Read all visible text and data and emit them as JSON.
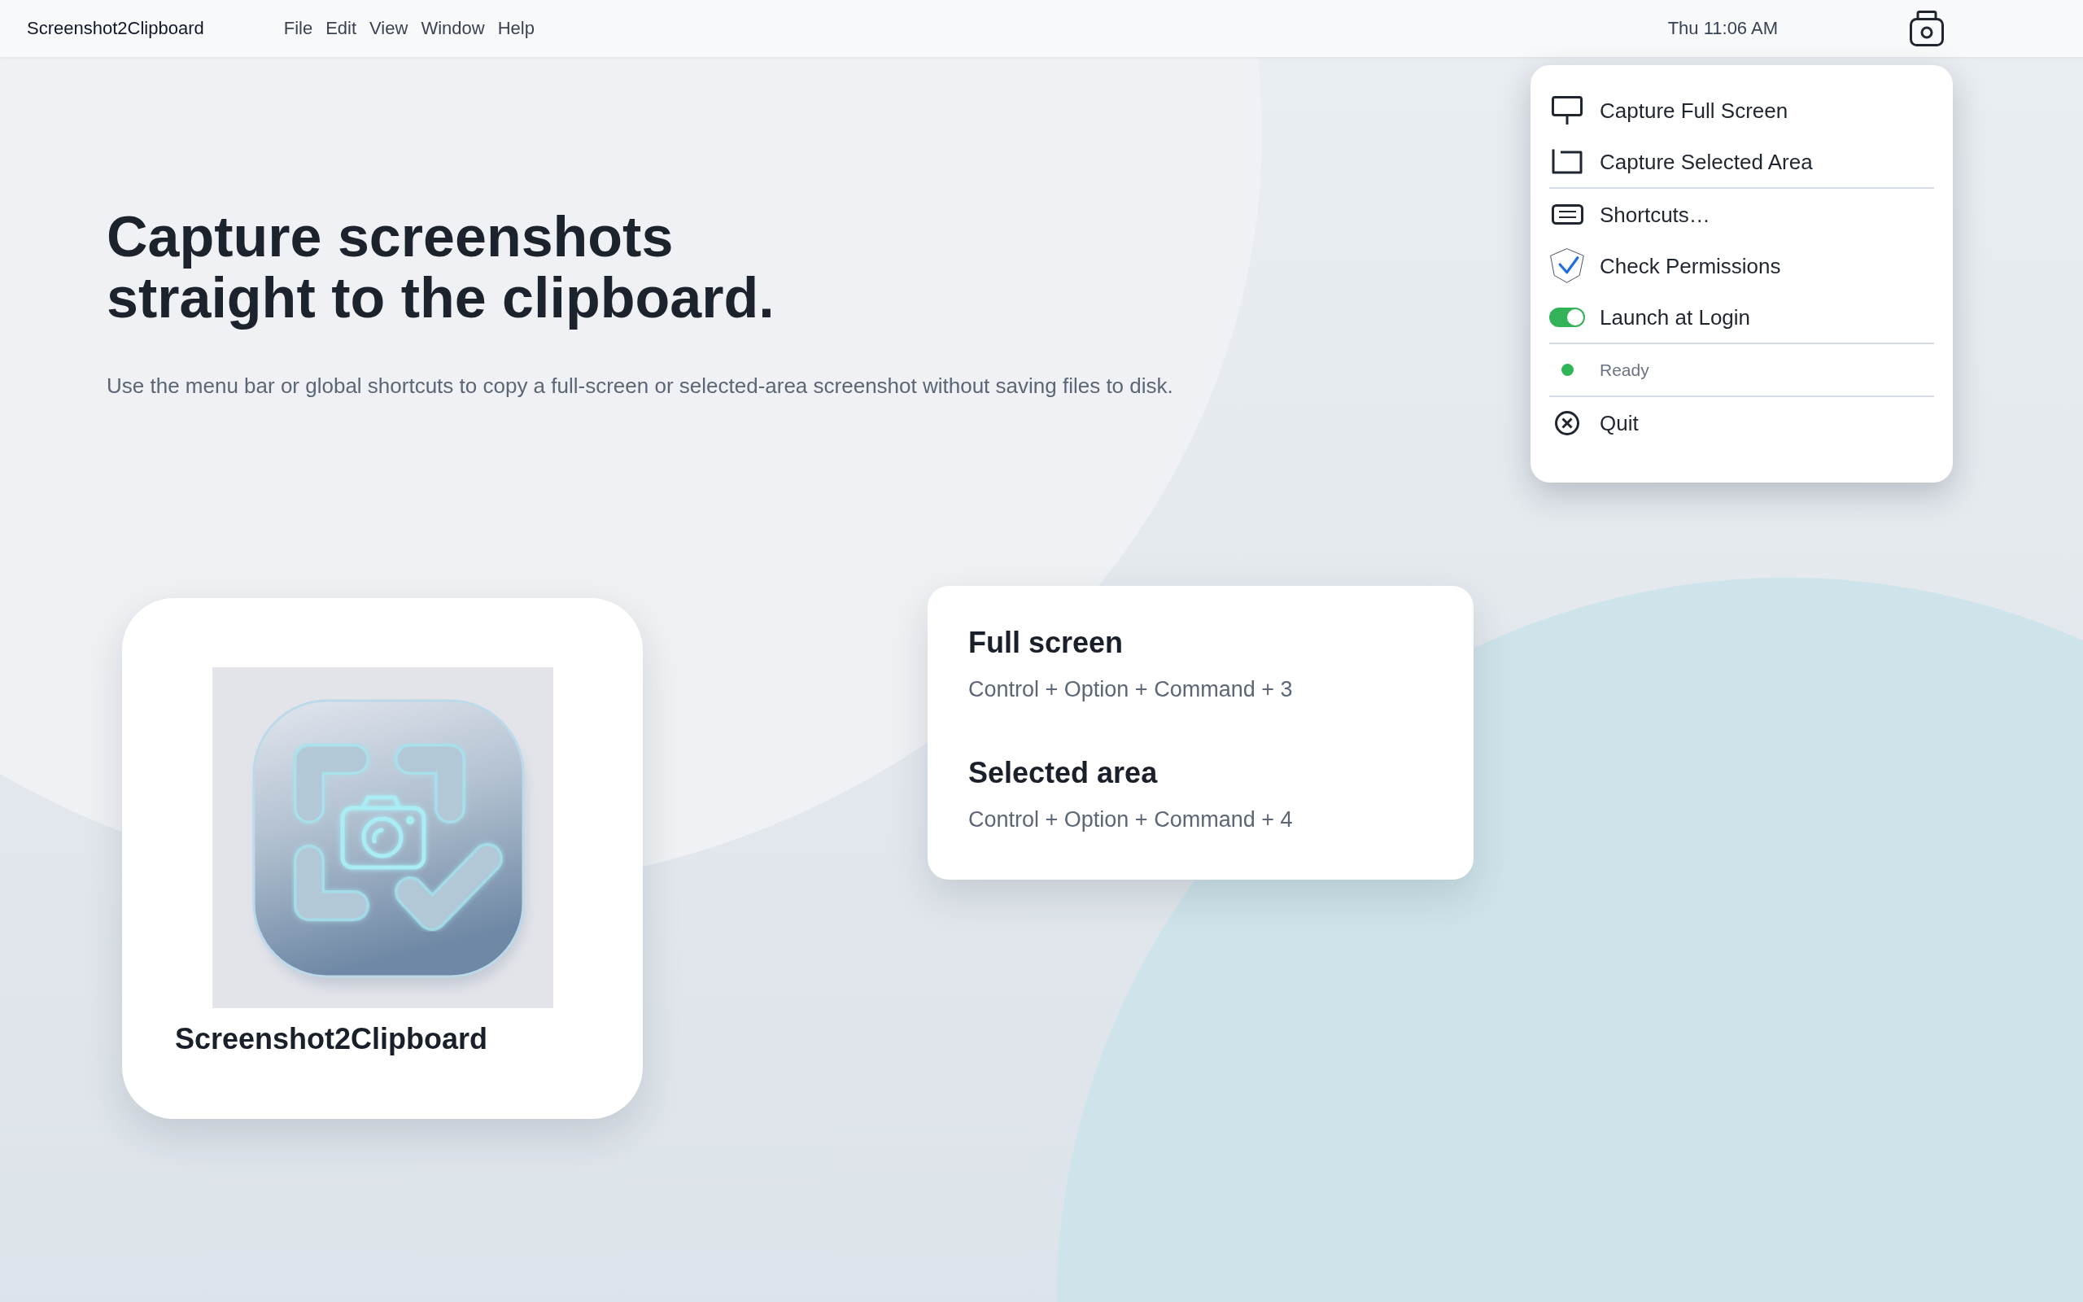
{
  "menu_bar": {
    "app_name": "Screenshot2Clipboard",
    "menus": [
      "File",
      "Edit",
      "View",
      "Window",
      "Help"
    ],
    "clock": "Thu 11:06 AM"
  },
  "status_menu": {
    "sections": [
      {
        "items": [
          {
            "kind": "action",
            "label": "Capture Full Screen"
          },
          {
            "kind": "action",
            "label": "Capture Selected Area"
          }
        ]
      },
      {
        "items": [
          {
            "kind": "action",
            "label": "Shortcuts…"
          },
          {
            "kind": "action",
            "label": "Check Permissions"
          },
          {
            "kind": "toggle",
            "label": "Launch at Login",
            "on": true
          }
        ]
      },
      {
        "items": [
          {
            "kind": "status",
            "label": "Ready",
            "color": "#2fb457"
          }
        ]
      },
      {
        "items": [
          {
            "kind": "action",
            "label": "Quit"
          }
        ]
      }
    ]
  },
  "hero": {
    "title": "Capture screenshots straight to the clipboard.",
    "subtitle": "Use the menu bar or global shortcuts to copy a full-screen or selected-area screenshot without saving files to disk."
  },
  "app_card": {
    "name": "Screenshot2Clipboard"
  },
  "shortcuts_card": {
    "shortcuts": [
      {
        "title": "Full screen",
        "keys": "Control + Option + Command + 3"
      },
      {
        "title": "Selected area",
        "keys": "Control + Option + Command + 4"
      }
    ]
  }
}
